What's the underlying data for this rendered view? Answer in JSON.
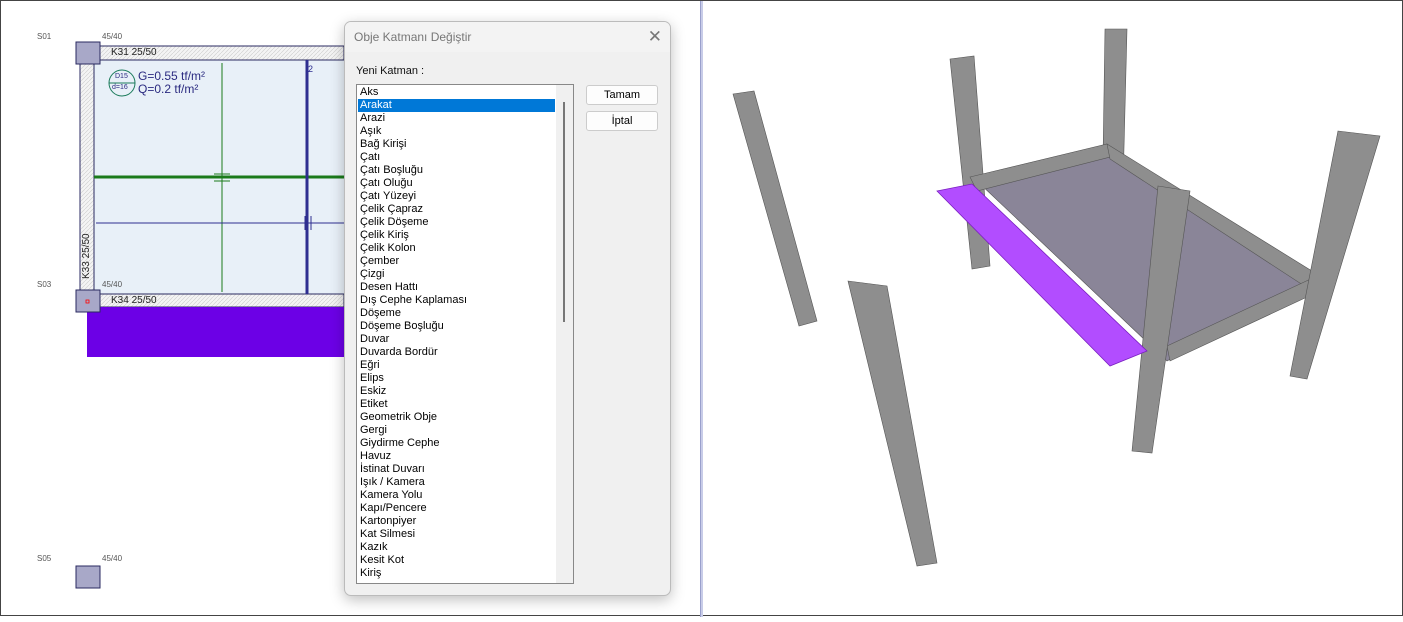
{
  "plan": {
    "columns": [
      {
        "name": "S01",
        "size": "45/40"
      },
      {
        "name": "S03",
        "size": "45/40"
      },
      {
        "name": "S05",
        "size": "45/40"
      }
    ],
    "beams": {
      "top": "K31 25/50",
      "left": "K33 25/50",
      "bottom": "K34 25/50"
    },
    "slab": {
      "tag_top": "D15",
      "tag_bottom": "d=16",
      "load_g": "G=0.55 tf/m²",
      "load_q": "Q=0.2 tf/m²",
      "axis_mark": "2"
    },
    "colors": {
      "selection": "#6c00e6",
      "slab_fill": "#e8f0f8",
      "rebar_green": "#1a7a1a",
      "axis_blue": "#2e2e90"
    }
  },
  "dialog": {
    "title": "Obje Katmanı Değiştir",
    "label": "Yeni Katman :",
    "ok": "Tamam",
    "cancel": "İptal",
    "selected": "Arakat",
    "items": [
      "Aks",
      "Arakat",
      "Arazi",
      "Aşık",
      "Bağ Kirişi",
      "Çatı",
      "Çatı Boşluğu",
      "Çatı Oluğu",
      "Çatı Yüzeyi",
      "Çelik Çapraz",
      "Çelik Döşeme",
      "Çelik Kiriş",
      "Çelik Kolon",
      "Çember",
      "Çizgi",
      "Desen Hattı",
      "Dış Cephe Kaplaması",
      "Döşeme",
      "Döşeme Boşluğu",
      "Duvar",
      "Duvarda Bordür",
      "Eğri",
      "Elips",
      "Eskiz",
      "Etiket",
      "Geometrik Obje",
      "Gergi",
      "Giydirme Cephe",
      "Havuz",
      "İstinat Duvarı",
      "Işık / Kamera",
      "Kamera Yolu",
      "Kapı/Pencere",
      "Kartonpiyer",
      "Kat Silmesi",
      "Kazık",
      "Kesit Kot",
      "Kiriş"
    ]
  },
  "view3d": {
    "colors": {
      "concrete": "#8e8e8e",
      "slab": "#8a8598",
      "selected_beam": "#b24dff"
    }
  }
}
